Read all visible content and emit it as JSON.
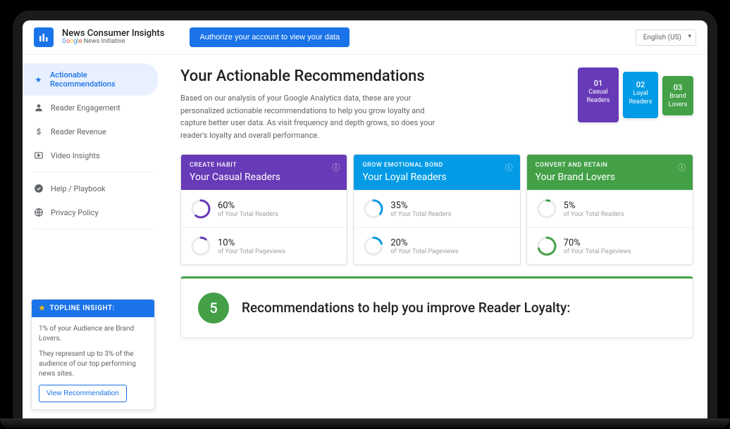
{
  "brand": {
    "title": "News Consumer Insights",
    "subtitle_google": "Google",
    "subtitle_rest": " News Initiative"
  },
  "header": {
    "auth_button": "Authorize your account to view your data",
    "language": "English (US)"
  },
  "sidebar": {
    "items": [
      {
        "label": "Actionable Recommendations",
        "icon": "star"
      },
      {
        "label": "Reader Engagement",
        "icon": "person"
      },
      {
        "label": "Reader Revenue",
        "icon": "dollar"
      },
      {
        "label": "Video Insights",
        "icon": "video"
      },
      {
        "label": "Help / Playbook",
        "icon": "check"
      },
      {
        "label": "Privacy Policy",
        "icon": "globe"
      }
    ]
  },
  "insight": {
    "heading": "TOPLINE INSIGHT:",
    "line1": "1% of your Audience are Brand Lovers.",
    "line2": "They represent up to 3% of the audience of our top performing news sites.",
    "button": "View Recommendation"
  },
  "hero": {
    "title": "Your Actionable Recommendations",
    "desc": "Based on our analysis of your Google Analytics data, these are your personalized actionable recommendations to help you grow loyalty and capture better user data. As visit frequency and depth grows, so does your reader's loyalty and overall performance."
  },
  "pills": [
    {
      "num": "01",
      "label": "Casual Readers"
    },
    {
      "num": "02",
      "label": "Loyal Readers"
    },
    {
      "num": "03",
      "label": "Brand Lovers"
    }
  ],
  "segments": [
    {
      "tag": "CREATE HABIT",
      "title": "Your Casual Readers",
      "color": "purple",
      "hex": "#673ab7",
      "stats": [
        {
          "value": "60%",
          "pct": 60,
          "label": "of Your Total Readers"
        },
        {
          "value": "10%",
          "pct": 10,
          "label": "of Your Total Pageviews"
        }
      ]
    },
    {
      "tag": "GROW EMOTIONAL BOND",
      "title": "Your Loyal Readers",
      "color": "blue",
      "hex": "#039be5",
      "stats": [
        {
          "value": "35%",
          "pct": 35,
          "label": "of Your Total Readers"
        },
        {
          "value": "20%",
          "pct": 20,
          "label": "of Your Total Pageviews"
        }
      ]
    },
    {
      "tag": "CONVERT AND RETAIN",
      "title": "Your Brand Lovers",
      "color": "green",
      "hex": "#43a047",
      "stats": [
        {
          "value": "5%",
          "pct": 5,
          "label": "of Your Total Readers"
        },
        {
          "value": "70%",
          "pct": 70,
          "label": "of Your Total Pageviews"
        }
      ]
    }
  ],
  "recommendations": {
    "count": "5",
    "title": "Recommendations to help you improve Reader Loyalty:"
  }
}
